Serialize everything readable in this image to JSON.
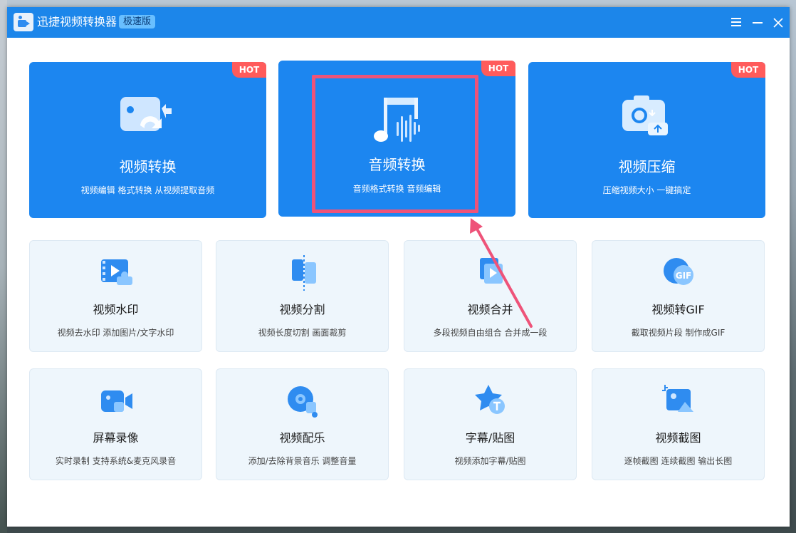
{
  "window": {
    "title": "迅捷视频转换器",
    "edition": "极速版"
  },
  "hot_label": "HOT",
  "featured": [
    {
      "title": "视频转换",
      "subtitle": "视频编辑 格式转换 从视频提取音频",
      "icon": "video-convert-icon",
      "hot": true
    },
    {
      "title": "音频转换",
      "subtitle": "音频格式转换 音频编辑",
      "icon": "music-note-icon",
      "hot": true
    },
    {
      "title": "视频压缩",
      "subtitle": "压缩视频大小 一键搞定",
      "icon": "video-compress-icon",
      "hot": true
    }
  ],
  "tools": [
    {
      "title": "视频水印",
      "subtitle": "视频去水印 添加图片/文字水印",
      "icon": "video-watermark-icon"
    },
    {
      "title": "视频分割",
      "subtitle": "视频长度切割 画面裁剪",
      "icon": "video-split-icon"
    },
    {
      "title": "视频合并",
      "subtitle": "多段视频自由组合 合并成一段",
      "icon": "video-merge-icon"
    },
    {
      "title": "视频转GIF",
      "subtitle": "截取视频片段 制作成GIF",
      "icon": "gif-icon"
    },
    {
      "title": "屏幕录像",
      "subtitle": "实时录制 支持系统&麦克风录音",
      "icon": "screen-record-icon"
    },
    {
      "title": "视频配乐",
      "subtitle": "添加/去除背景音乐 调整音量",
      "icon": "video-music-icon"
    },
    {
      "title": "字幕/贴图",
      "subtitle": "视频添加字幕/贴图",
      "icon": "subtitle-sticker-icon"
    },
    {
      "title": "视频截图",
      "subtitle": "逐帧截图 连续截图 输出长图",
      "icon": "video-screenshot-icon"
    }
  ],
  "gif_icon_text": "GIF",
  "colors": {
    "titlebar": "#1c86ea",
    "featured_card": "#1c86f0",
    "hot_badge": "#ff5b5b",
    "tool_card": "#eef6fc",
    "annotation": "#ee5379"
  }
}
